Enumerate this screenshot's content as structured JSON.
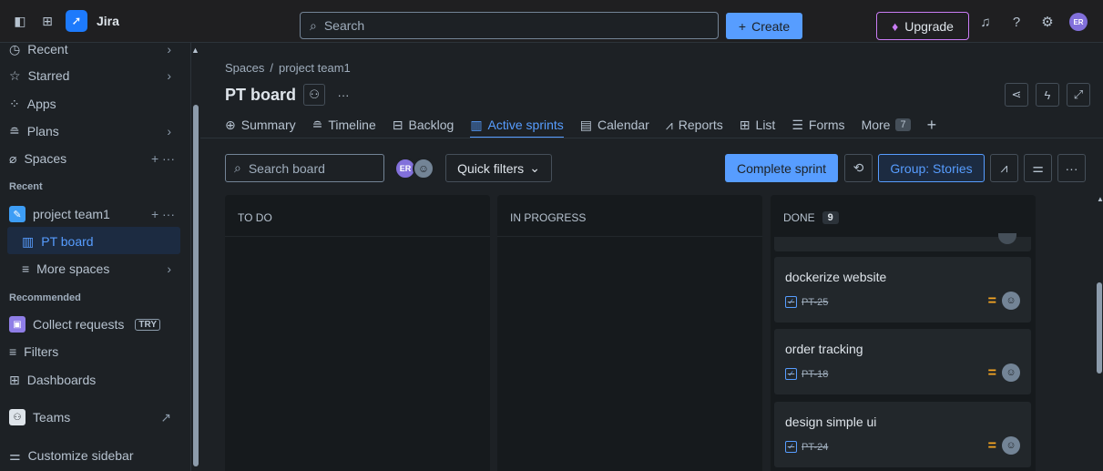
{
  "topbar": {
    "brand": "Jira",
    "search_placeholder": "Search",
    "create_label": "Create",
    "upgrade_label": "Upgrade",
    "avatar_initials": "ER"
  },
  "sidebar": {
    "recent_top": "Recent",
    "starred": "Starred",
    "apps": "Apps",
    "plans": "Plans",
    "spaces": "Spaces",
    "section_recent": "Recent",
    "project": "project team1",
    "pt_board": "PT board",
    "more_spaces": "More spaces",
    "section_recommended": "Recommended",
    "collect_requests": "Collect requests",
    "try_badge": "TRY",
    "filters": "Filters",
    "dashboards": "Dashboards",
    "teams": "Teams",
    "customize": "Customize sidebar"
  },
  "breadcrumb": {
    "spaces": "Spaces",
    "sep": "/",
    "project": "project team1"
  },
  "board": {
    "title": "PT board",
    "more": "···"
  },
  "tabs": [
    {
      "label": "Summary"
    },
    {
      "label": "Timeline"
    },
    {
      "label": "Backlog"
    },
    {
      "label": "Active sprints"
    },
    {
      "label": "Calendar"
    },
    {
      "label": "Reports"
    },
    {
      "label": "List"
    },
    {
      "label": "Forms"
    },
    {
      "label": "More"
    }
  ],
  "more_count": "7",
  "toolbar": {
    "search_placeholder": "Search board",
    "avatar_initials": "ER",
    "quick_filters": "Quick filters",
    "complete_sprint": "Complete sprint",
    "group_by": "Group: Stories"
  },
  "columns": [
    {
      "title": "TO DO",
      "count": ""
    },
    {
      "title": "IN PROGRESS",
      "count": ""
    },
    {
      "title": "DONE",
      "count": "9"
    }
  ],
  "cards": [
    {
      "title": "dockerize website",
      "key": "PT-25"
    },
    {
      "title": "order tracking",
      "key": "PT-18"
    },
    {
      "title": "design simple ui",
      "key": "PT-24"
    }
  ]
}
